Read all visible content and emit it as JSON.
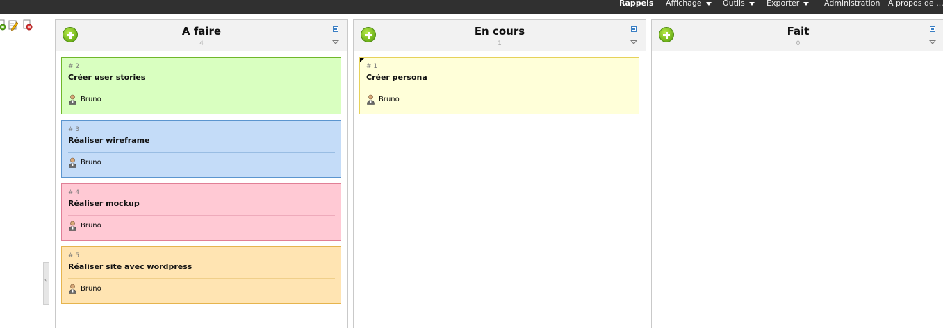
{
  "topnav": {
    "items": [
      {
        "label": "Rappels",
        "bold": true,
        "dropdown": false
      },
      {
        "label": "Affichage",
        "bold": false,
        "dropdown": true
      },
      {
        "label": "Outils",
        "bold": false,
        "dropdown": true
      },
      {
        "label": "Exporter",
        "bold": false,
        "dropdown": true
      },
      {
        "label": "Administration",
        "bold": false,
        "dropdown": false
      },
      {
        "label": "A propos de ...",
        "bold": false,
        "dropdown": false
      }
    ]
  },
  "sidebar": {
    "tools": [
      "add-page-icon",
      "edit-page-icon",
      "delete-page-icon"
    ],
    "splitter_glyph": "‹"
  },
  "columns": [
    {
      "title": "A faire",
      "count": "4",
      "cards": [
        {
          "number": "# 2",
          "title": "Créer user stories",
          "owner": "Bruno",
          "bg": "#d9ffc0",
          "border": "#6fb72a",
          "divider": "#b3dd95"
        },
        {
          "number": "# 3",
          "title": "Réaliser wireframe",
          "owner": "Bruno",
          "bg": "#c4dcf8",
          "border": "#5b95cf",
          "divider": "#99bde3"
        },
        {
          "number": "# 4",
          "title": "Réaliser mockup",
          "owner": "Bruno",
          "bg": "#ffc9d4",
          "border": "#e07f96",
          "divider": "#eeaabb"
        },
        {
          "number": "# 5",
          "title": "Réaliser site avec wordpress",
          "owner": "Bruno",
          "bg": "#ffe4b2",
          "border": "#e6b44e",
          "divider": "#f0cf8a"
        }
      ]
    },
    {
      "title": "En cours",
      "count": "1",
      "cards": [
        {
          "number": "# 1",
          "title": "Créer persona",
          "owner": "Bruno",
          "bg": "#ffffd9",
          "border": "#e6d25a",
          "divider": "#ece7a8",
          "flag": true
        }
      ]
    },
    {
      "title": "Fait",
      "count": "0",
      "cards": []
    }
  ],
  "colors": {
    "topbar": "#303030",
    "column_header": "#f2f2f2",
    "add_button": "#6fb21a"
  }
}
